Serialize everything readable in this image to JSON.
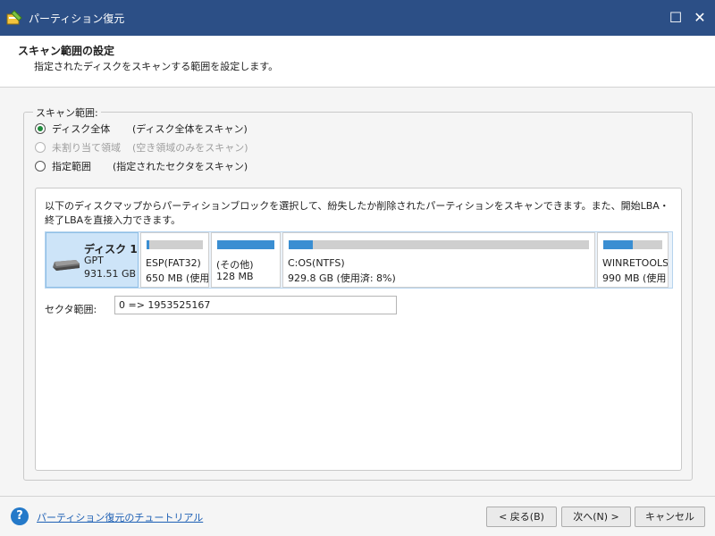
{
  "window": {
    "title": "パーティション復元",
    "maximize_glyph": "☐",
    "close_glyph": "✕",
    "bg_color": "#2c4f86"
  },
  "header": {
    "title": "スキャン範囲の設定",
    "subtitle": "指定されたディスクをスキャンする範囲を設定します。"
  },
  "scan_range": {
    "group_label": "スキャン範囲:",
    "options": [
      {
        "label": "ディスク全体",
        "desc": "(ディスク全体をスキャン)",
        "checked": true,
        "enabled": true
      },
      {
        "label": "未割り当て領域",
        "desc": "(空き領域のみをスキャン)",
        "checked": false,
        "enabled": false
      },
      {
        "label": "指定範囲",
        "desc": "(指定されたセクタをスキャン)",
        "checked": false,
        "enabled": true
      }
    ]
  },
  "info_text": "以下のディスクマップからパーティションブロックを選択して、紛失したか削除されたパーティションをスキャンできます。また、開始LBA・終了LBAを直接入力できます。",
  "disk": {
    "name": "ディスク 1",
    "type": "GPT",
    "size": "931.51 GB",
    "partitions": [
      {
        "name": "ESP(FAT32)",
        "size": "650 MB (使用",
        "used_fraction": 0.05
      },
      {
        "name": "(その他)",
        "size": "128 MB",
        "used_fraction": 1.0
      },
      {
        "name": "C:OS(NTFS)",
        "size": "929.8 GB (使用済: 8%)",
        "used_fraction": 0.08
      },
      {
        "name": "WINRETOOLS",
        "size": "990 MB (使用",
        "used_fraction": 0.5
      }
    ]
  },
  "sector": {
    "label": "セクタ範囲:",
    "value": "0 => 1953525167"
  },
  "footer": {
    "help_glyph": "?",
    "tutorial_link": "パーティション復元のチュートリアル",
    "back_label": "< 戻る(B)",
    "next_label": "次へ(N) >",
    "cancel_label": "キャンセル"
  }
}
